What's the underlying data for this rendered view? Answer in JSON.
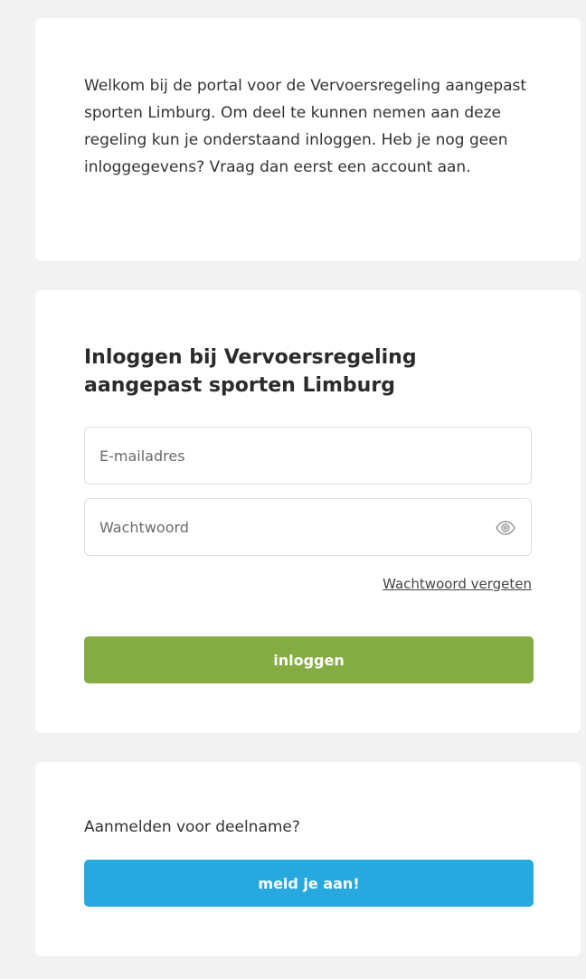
{
  "intro": {
    "text": "Welkom bij de portal voor de Vervoersregeling aangepast sporten Limburg. Om deel te kunnen nemen aan deze regeling kun je onderstaand inloggen. Heb je nog geen inloggegevens? Vraag dan eerst een account aan."
  },
  "login": {
    "title": "Inloggen bij Vervoersregeling aangepast sporten Limburg",
    "email_placeholder": "E-mailadres",
    "email_value": "",
    "password_placeholder": "Wachtwoord",
    "password_value": "",
    "password_toggle_icon": "eye-icon",
    "forgot_password_label": "Wachtwoord vergeten",
    "submit_label": "inloggen",
    "submit_color": "#85ab43"
  },
  "register": {
    "prompt": "Aanmelden voor deelname?",
    "button_label": "meld je aan!",
    "button_color": "#27a8df"
  }
}
